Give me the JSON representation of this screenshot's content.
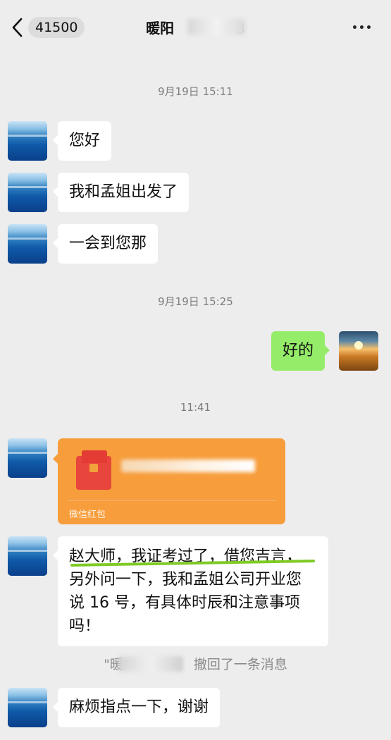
{
  "header": {
    "unread_count": "41500",
    "contact_name": "暖阳",
    "contact_name_suffix": "3"
  },
  "timestamps": [
    "9月19日 15:11",
    "9月19日 15:25",
    "11:41"
  ],
  "messages": [
    {
      "sender": "contact",
      "text": "您好"
    },
    {
      "sender": "contact",
      "text": "我和孟姐出发了"
    },
    {
      "sender": "contact",
      "text": "一会到您那"
    },
    {
      "sender": "me",
      "text": "好的"
    },
    {
      "sender": "contact",
      "type": "red-packet",
      "label": "微信红包"
    },
    {
      "sender": "contact",
      "lines": [
        "赵大师，我证考过了，借您吉言，",
        "另外问一下，我和孟姐公司开业您",
        "说 16 号，有具体时辰和注意事项",
        "吗！"
      ]
    },
    {
      "sender": "contact",
      "text": "麻烦指点一下，谢谢"
    }
  ],
  "recall_notice": {
    "prefix": "\"暖",
    "suffix": "撤回了一条消息"
  },
  "colors": {
    "background": "#ededed",
    "my_bubble": "#95ec69",
    "red_packet": "#f79d3b"
  }
}
